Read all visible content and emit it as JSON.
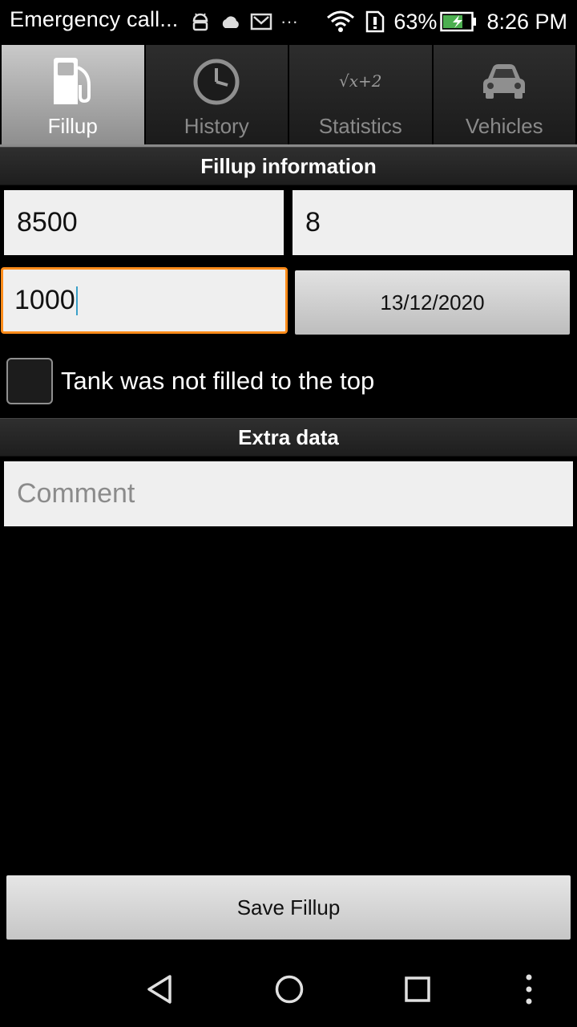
{
  "status_bar": {
    "carrier": "Emergency call...",
    "battery_pct": "63%",
    "time": "8:26 PM",
    "icons": [
      "android-icon",
      "cloud-icon",
      "gmail-icon",
      "more-dots-icon",
      "wifi-icon",
      "sim-alert-icon",
      "battery-charging-icon"
    ]
  },
  "tabs": [
    {
      "label": "Fillup",
      "icon": "fuel-pump-icon",
      "active": true
    },
    {
      "label": "History",
      "icon": "clock-icon",
      "active": false
    },
    {
      "label": "Statistics",
      "icon": "formula-icon",
      "icon_text": "√x+2",
      "active": false
    },
    {
      "label": "Vehicles",
      "icon": "car-icon",
      "active": false
    }
  ],
  "fillup_section": {
    "title": "Fillup information",
    "field1_value": "8500",
    "field2_value": "8",
    "field3_value": "1000",
    "date_value": "13/12/2020",
    "not_full_label": "Tank was not filled to the top",
    "not_full_checked": false
  },
  "extra_section": {
    "title": "Extra data",
    "comment_placeholder": "Comment"
  },
  "save_button_label": "Save Fillup",
  "colors": {
    "focus_border": "#ff8c1a",
    "field_bg": "#efefef",
    "background": "#000000",
    "battery_green": "#4caf50"
  },
  "nav_bar": [
    "back-icon",
    "home-icon",
    "recents-icon",
    "menu-icon"
  ]
}
